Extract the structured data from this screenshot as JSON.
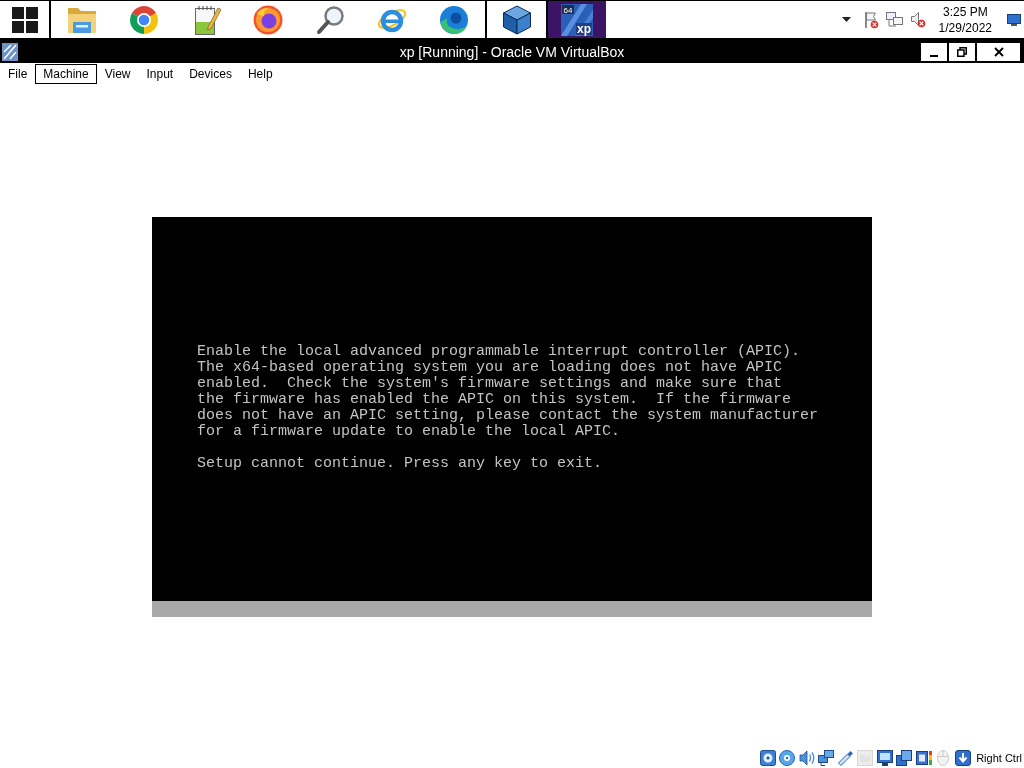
{
  "taskbar": {
    "app_groups": [
      [
        {
          "kind": "start",
          "selected": false
        }
      ],
      [
        {
          "kind": "folder",
          "selected": false
        },
        {
          "kind": "chrome",
          "selected": false
        },
        {
          "kind": "notepad",
          "selected": false
        },
        {
          "kind": "firefox",
          "selected": false
        },
        {
          "kind": "magnifier",
          "selected": false
        },
        {
          "kind": "ie",
          "selected": false
        },
        {
          "kind": "edge",
          "selected": false
        }
      ],
      [
        {
          "kind": "cube",
          "selected": false
        }
      ],
      [
        {
          "kind": "vm",
          "selected": true,
          "badge": "64",
          "caption": "xp"
        }
      ]
    ],
    "tray": [
      {
        "kind": "caret"
      },
      {
        "kind": "flag"
      },
      {
        "kind": "network"
      },
      {
        "kind": "speaker"
      }
    ],
    "clock": {
      "time": "3:25 PM",
      "date": "1/29/2022"
    }
  },
  "window": {
    "title": "xp [Running] - Oracle VM VirtualBox"
  },
  "menu": [
    {
      "label": "File",
      "selected": false
    },
    {
      "label": "Machine",
      "selected": true
    },
    {
      "label": "View",
      "selected": false
    },
    {
      "label": "Input",
      "selected": false
    },
    {
      "label": "Devices",
      "selected": false
    },
    {
      "label": "Help",
      "selected": false
    }
  ],
  "vm_screen": {
    "paragraphs": [
      [
        "Enable the local advanced programmable interrupt controller (APIC).",
        "The x64-based operating system you are loading does not have APIC",
        "enabled.  Check the system's firmware settings and make sure that",
        "the firmware has enabled the APIC on this system.  If the firmware",
        "does not have an APIC setting, please contact the system manufacturer",
        "for a firmware update to enable the local APIC."
      ],
      [
        "Setup cannot continue. Press any key to exit."
      ]
    ]
  },
  "status_bar": {
    "indicators": [
      {
        "kind": "hard-disk",
        "disabled": false
      },
      {
        "kind": "optical",
        "disabled": false
      },
      {
        "kind": "audio",
        "disabled": false
      },
      {
        "kind": "network",
        "disabled": false
      },
      {
        "kind": "usb",
        "disabled": false
      },
      {
        "kind": "shared-folders",
        "disabled": true
      },
      {
        "kind": "display",
        "disabled": false
      },
      {
        "kind": "recording",
        "disabled": false
      },
      {
        "kind": "cpu",
        "disabled": false
      },
      {
        "kind": "mouse",
        "disabled": true
      },
      {
        "kind": "keyboard",
        "disabled": false
      }
    ],
    "host_key": "Right Ctrl"
  }
}
